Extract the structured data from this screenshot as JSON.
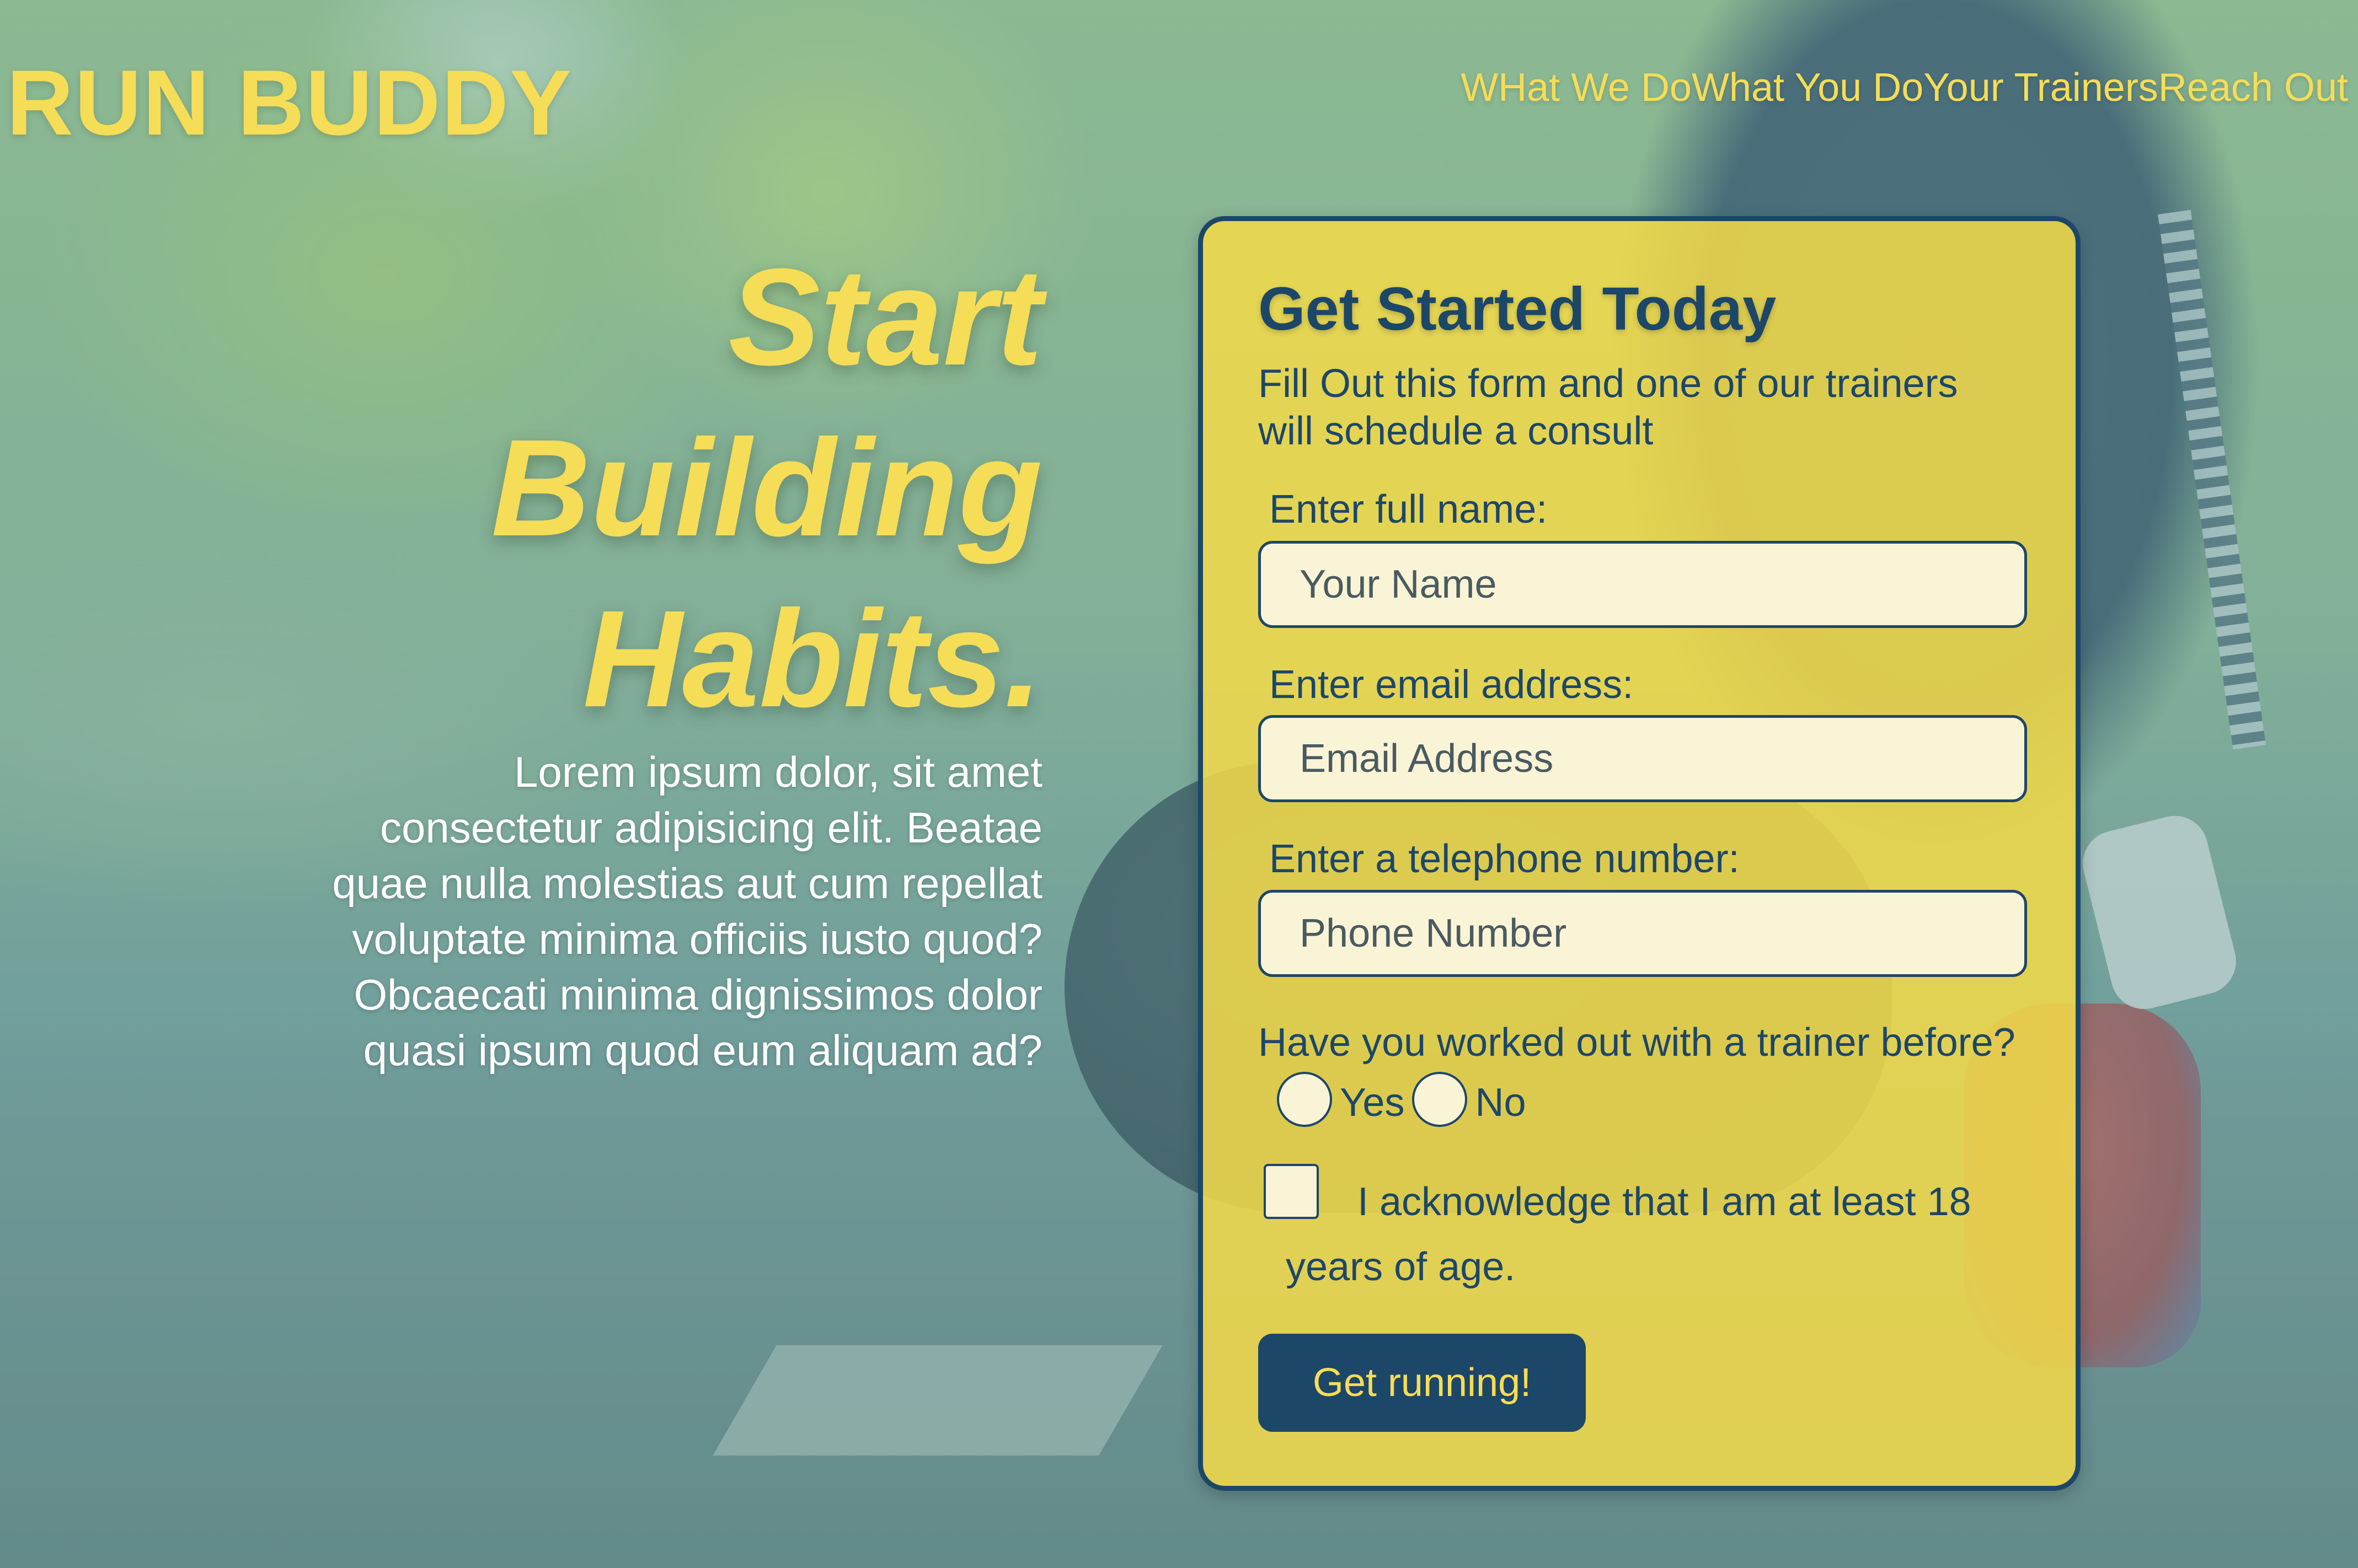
{
  "brand": {
    "logo": "RUN BUDDY"
  },
  "nav": {
    "items": [
      "WHat We Do",
      "What You Do",
      "Your Trainers",
      "Reach Out"
    ]
  },
  "hero": {
    "title_lines": [
      "Start",
      "Building",
      "Habits."
    ],
    "body_lines": [
      "Lorem ipsum dolor, sit amet",
      "consectetur adipisicing elit. Beatae",
      "quae nulla molestias aut cum repellat",
      "voluptate minima officiis iusto quod?",
      "Obcaecati minima dignissimos dolor",
      "quasi ipsum quod eum aliquam ad?"
    ]
  },
  "form": {
    "title": "Get Started Today",
    "subtitle": "Fill Out this form and one of our trainers will schedule a consult",
    "name": {
      "label": "Enter full name:",
      "placeholder": "Your Name",
      "value": ""
    },
    "email": {
      "label": "Enter email address:",
      "placeholder": "Email Address",
      "value": ""
    },
    "phone": {
      "label": "Enter a telephone number:",
      "placeholder": "Phone Number",
      "value": ""
    },
    "trainer_question": {
      "question": "Have you worked out with a trainer before?",
      "options": [
        "Yes",
        "No"
      ],
      "selected": null
    },
    "age_ack": {
      "label": "I acknowledge that I am at least 18 years of age.",
      "checked": false
    },
    "submit_label": "Get running!"
  },
  "colors": {
    "accent_yellow": "#f6dd57",
    "navy": "#1d4769",
    "card_bg": "#f3da48",
    "input_bg": "#faf4d6"
  }
}
